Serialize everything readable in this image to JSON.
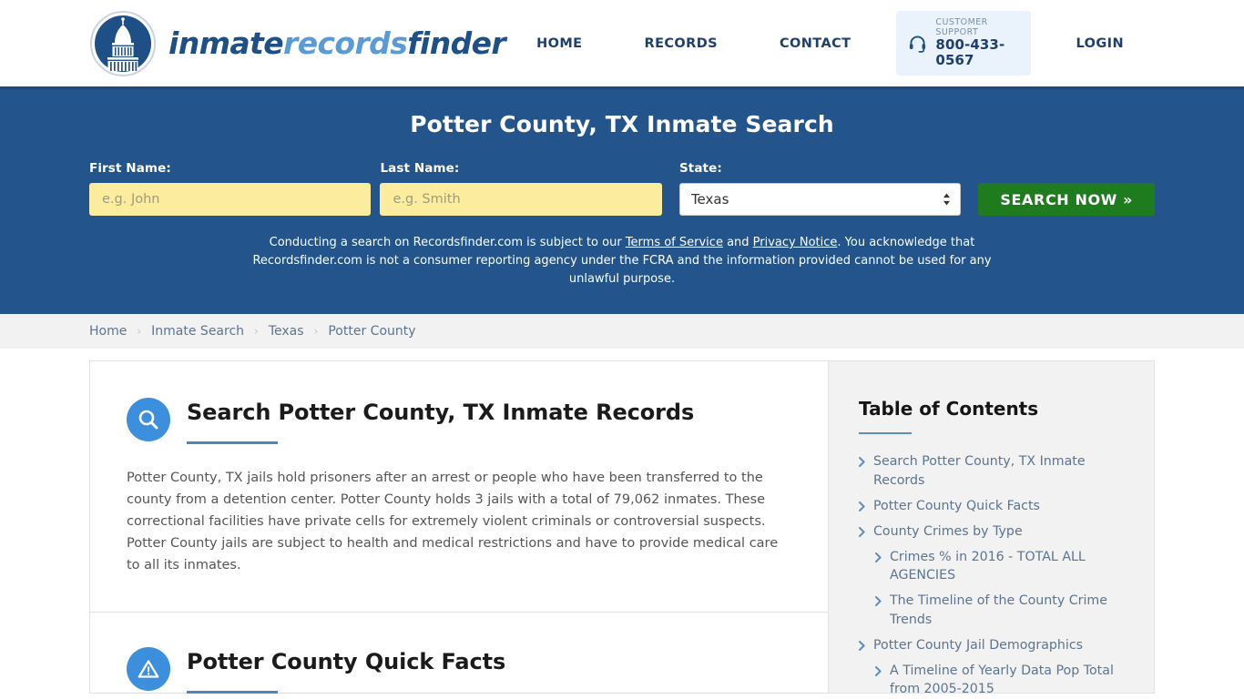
{
  "header": {
    "brand": {
      "part1": "inmate",
      "part2": "records",
      "part3": "finder"
    },
    "logo_icon": "capitol-dome-icon",
    "nav": [
      {
        "label": "HOME",
        "name": "nav-home"
      },
      {
        "label": "RECORDS",
        "name": "nav-records"
      },
      {
        "label": "CONTACT",
        "name": "nav-contact"
      }
    ],
    "support": {
      "icon": "headset-icon",
      "label": "CUSTOMER SUPPORT",
      "phone": "800-433-0567"
    },
    "login_label": "LOGIN"
  },
  "hero": {
    "title": "Potter County, TX Inmate Search",
    "first_name": {
      "label": "First Name:",
      "placeholder": "e.g. John",
      "value": ""
    },
    "last_name": {
      "label": "Last Name:",
      "placeholder": "e.g. Smith",
      "value": ""
    },
    "state": {
      "label": "State:",
      "selected": "Texas",
      "options": [
        "Texas"
      ]
    },
    "search_button": "SEARCH NOW »",
    "disclaimer": {
      "part1": "Conducting a search on Recordsfinder.com is subject to our ",
      "link1": "Terms of Service",
      "part2": " and ",
      "link2": "Privacy Notice",
      "part3": ". You acknowledge that Recordsfinder.com is not a consumer reporting agency under the FCRA and the information provided cannot be used for any unlawful purpose."
    }
  },
  "breadcrumb": {
    "separator": "›",
    "items": [
      {
        "label": "Home"
      },
      {
        "label": "Inmate Search"
      },
      {
        "label": "Texas"
      },
      {
        "label": "Potter County"
      }
    ]
  },
  "content": {
    "sections": [
      {
        "icon": "magnifier-icon",
        "title": "Search Potter County, TX Inmate Records",
        "body": "Potter County, TX jails hold prisoners after an arrest or people who have been transferred to the county from a detention center. Potter County holds 3 jails with a total of 79,062 inmates. These correctional facilities have private cells for extremely violent criminals or controversial suspects. Potter County jails are subject to health and medical restrictions and have to provide medical care to all its inmates."
      },
      {
        "icon": "warning-triangle-icon",
        "title": "Potter County Quick Facts",
        "body": ""
      }
    ]
  },
  "sidebar": {
    "title": "Table of Contents",
    "chevron_icon": "chevron-right-icon",
    "items": [
      {
        "label": "Search Potter County, TX Inmate Records",
        "level": 1
      },
      {
        "label": "Potter County Quick Facts",
        "level": 1
      },
      {
        "label": "County Crimes by Type",
        "level": 1
      },
      {
        "label": "Crimes % in 2016 - TOTAL ALL AGENCIES",
        "level": 2
      },
      {
        "label": "The Timeline of the County Crime Trends",
        "level": 2
      },
      {
        "label": "Potter County Jail Demographics",
        "level": 1
      },
      {
        "label": "A Timeline of Yearly Data Pop Total from 2005-2015",
        "level": 2
      }
    ]
  },
  "colors": {
    "hero_blue": "#23558c",
    "green_button": "#1e7b1e",
    "input_yellow": "#fbec9e",
    "accent_blue": "#3b8fdd",
    "link_slate": "#5b7490",
    "sidebar_gray": "#f2f2f2"
  }
}
